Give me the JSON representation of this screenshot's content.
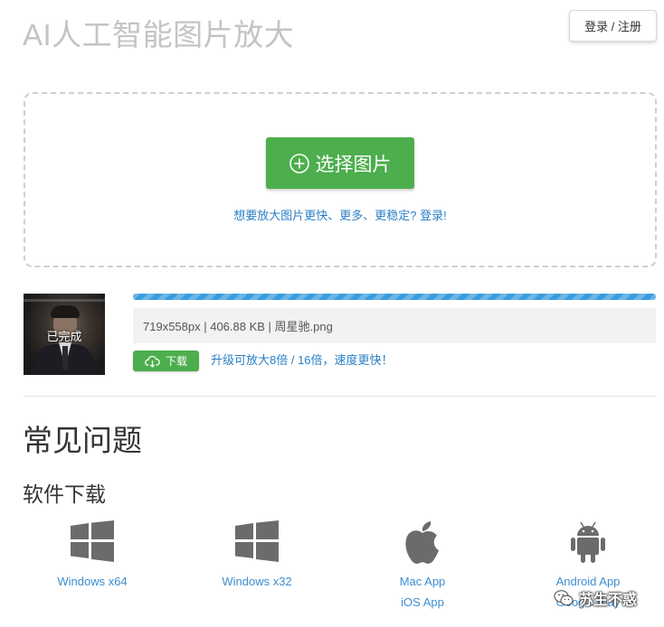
{
  "header": {
    "title": "AI人工智能图片放大",
    "login_label": "登录 / 注册"
  },
  "upload": {
    "select_label": "选择图片",
    "hint": "想要放大图片更快、更多、更稳定? 登录!"
  },
  "result": {
    "status": "已完成",
    "progress": 1.0,
    "file_info": "719x558px | 406.88 KB | 周星驰.png",
    "download_label": "下载",
    "upgrade_text": "升级可放大8倍 / 16倍，速度更快！"
  },
  "faq": {
    "title": "常见问题"
  },
  "software": {
    "title": "软件下载",
    "items": [
      {
        "icon": "windows-icon",
        "links": [
          "Windows x64"
        ]
      },
      {
        "icon": "windows-icon",
        "links": [
          "Windows x32"
        ]
      },
      {
        "icon": "apple-icon",
        "links": [
          "Mac App",
          "iOS App"
        ]
      },
      {
        "icon": "android-icon",
        "links": [
          "Android App",
          "Google Play"
        ]
      }
    ]
  },
  "watermark": {
    "text": "苏生不惑",
    "icon": "wechat-icon"
  },
  "colors": {
    "accent_green": "#4cae4c",
    "link_blue": "#2a7fc5",
    "progress_blue": "#3a9be0",
    "icon_gray": "#6b6b6b"
  }
}
